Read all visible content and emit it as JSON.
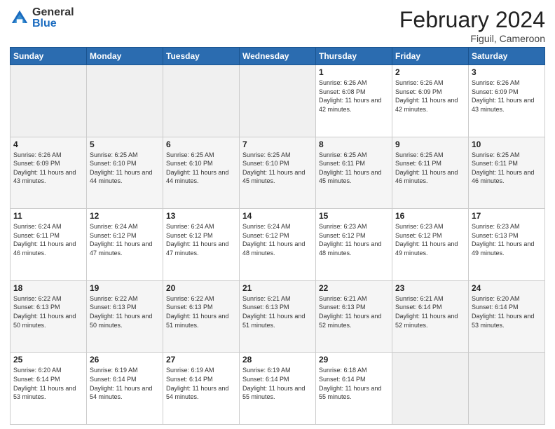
{
  "logo": {
    "general": "General",
    "blue": "Blue"
  },
  "title": {
    "month": "February 2024",
    "location": "Figuil, Cameroon"
  },
  "weekdays": [
    "Sunday",
    "Monday",
    "Tuesday",
    "Wednesday",
    "Thursday",
    "Friday",
    "Saturday"
  ],
  "weeks": [
    [
      {
        "day": "",
        "empty": true
      },
      {
        "day": "",
        "empty": true
      },
      {
        "day": "",
        "empty": true
      },
      {
        "day": "",
        "empty": true
      },
      {
        "day": "1",
        "sunrise": "6:26 AM",
        "sunset": "6:08 PM",
        "daylight": "11 hours and 42 minutes."
      },
      {
        "day": "2",
        "sunrise": "6:26 AM",
        "sunset": "6:09 PM",
        "daylight": "11 hours and 42 minutes."
      },
      {
        "day": "3",
        "sunrise": "6:26 AM",
        "sunset": "6:09 PM",
        "daylight": "11 hours and 43 minutes."
      }
    ],
    [
      {
        "day": "4",
        "sunrise": "6:26 AM",
        "sunset": "6:09 PM",
        "daylight": "11 hours and 43 minutes."
      },
      {
        "day": "5",
        "sunrise": "6:25 AM",
        "sunset": "6:10 PM",
        "daylight": "11 hours and 44 minutes."
      },
      {
        "day": "6",
        "sunrise": "6:25 AM",
        "sunset": "6:10 PM",
        "daylight": "11 hours and 44 minutes."
      },
      {
        "day": "7",
        "sunrise": "6:25 AM",
        "sunset": "6:10 PM",
        "daylight": "11 hours and 45 minutes."
      },
      {
        "day": "8",
        "sunrise": "6:25 AM",
        "sunset": "6:11 PM",
        "daylight": "11 hours and 45 minutes."
      },
      {
        "day": "9",
        "sunrise": "6:25 AM",
        "sunset": "6:11 PM",
        "daylight": "11 hours and 46 minutes."
      },
      {
        "day": "10",
        "sunrise": "6:25 AM",
        "sunset": "6:11 PM",
        "daylight": "11 hours and 46 minutes."
      }
    ],
    [
      {
        "day": "11",
        "sunrise": "6:24 AM",
        "sunset": "6:11 PM",
        "daylight": "11 hours and 46 minutes."
      },
      {
        "day": "12",
        "sunrise": "6:24 AM",
        "sunset": "6:12 PM",
        "daylight": "11 hours and 47 minutes."
      },
      {
        "day": "13",
        "sunrise": "6:24 AM",
        "sunset": "6:12 PM",
        "daylight": "11 hours and 47 minutes."
      },
      {
        "day": "14",
        "sunrise": "6:24 AM",
        "sunset": "6:12 PM",
        "daylight": "11 hours and 48 minutes."
      },
      {
        "day": "15",
        "sunrise": "6:23 AM",
        "sunset": "6:12 PM",
        "daylight": "11 hours and 48 minutes."
      },
      {
        "day": "16",
        "sunrise": "6:23 AM",
        "sunset": "6:12 PM",
        "daylight": "11 hours and 49 minutes."
      },
      {
        "day": "17",
        "sunrise": "6:23 AM",
        "sunset": "6:13 PM",
        "daylight": "11 hours and 49 minutes."
      }
    ],
    [
      {
        "day": "18",
        "sunrise": "6:22 AM",
        "sunset": "6:13 PM",
        "daylight": "11 hours and 50 minutes."
      },
      {
        "day": "19",
        "sunrise": "6:22 AM",
        "sunset": "6:13 PM",
        "daylight": "11 hours and 50 minutes."
      },
      {
        "day": "20",
        "sunrise": "6:22 AM",
        "sunset": "6:13 PM",
        "daylight": "11 hours and 51 minutes."
      },
      {
        "day": "21",
        "sunrise": "6:21 AM",
        "sunset": "6:13 PM",
        "daylight": "11 hours and 51 minutes."
      },
      {
        "day": "22",
        "sunrise": "6:21 AM",
        "sunset": "6:13 PM",
        "daylight": "11 hours and 52 minutes."
      },
      {
        "day": "23",
        "sunrise": "6:21 AM",
        "sunset": "6:14 PM",
        "daylight": "11 hours and 52 minutes."
      },
      {
        "day": "24",
        "sunrise": "6:20 AM",
        "sunset": "6:14 PM",
        "daylight": "11 hours and 53 minutes."
      }
    ],
    [
      {
        "day": "25",
        "sunrise": "6:20 AM",
        "sunset": "6:14 PM",
        "daylight": "11 hours and 53 minutes."
      },
      {
        "day": "26",
        "sunrise": "6:19 AM",
        "sunset": "6:14 PM",
        "daylight": "11 hours and 54 minutes."
      },
      {
        "day": "27",
        "sunrise": "6:19 AM",
        "sunset": "6:14 PM",
        "daylight": "11 hours and 54 minutes."
      },
      {
        "day": "28",
        "sunrise": "6:19 AM",
        "sunset": "6:14 PM",
        "daylight": "11 hours and 55 minutes."
      },
      {
        "day": "29",
        "sunrise": "6:18 AM",
        "sunset": "6:14 PM",
        "daylight": "11 hours and 55 minutes."
      },
      {
        "day": "",
        "empty": true
      },
      {
        "day": "",
        "empty": true
      }
    ]
  ]
}
